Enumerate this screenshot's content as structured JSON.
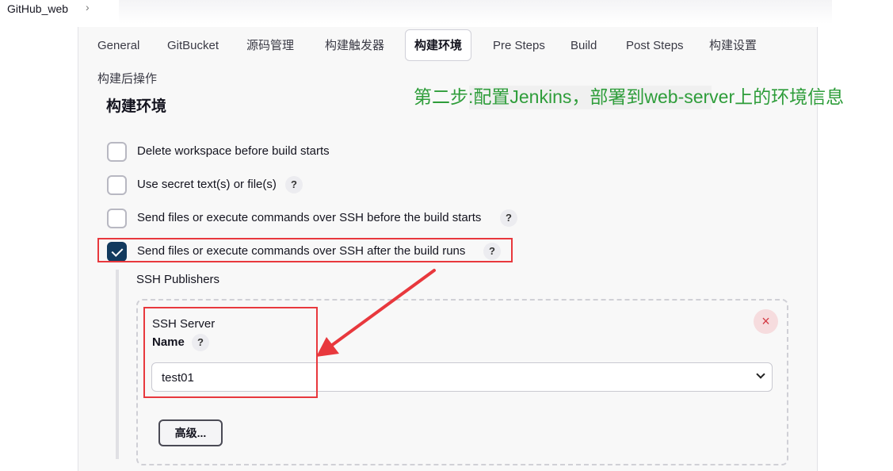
{
  "breadcrumb": {
    "project": "GitHub_web",
    "separator": "›"
  },
  "tabs": [
    {
      "label": "General"
    },
    {
      "label": "GitBucket"
    },
    {
      "label": "源码管理"
    },
    {
      "label": "构建触发器"
    },
    {
      "label": "构建环境",
      "active": true
    },
    {
      "label": "Pre Steps"
    },
    {
      "label": "Build"
    },
    {
      "label": "Post Steps"
    },
    {
      "label": "构建设置"
    },
    {
      "label": "构建后操作"
    }
  ],
  "section_title": "构建环境",
  "annotation": "第二步:配置Jenkins，部署到web-server上的环境信息",
  "options": [
    {
      "label": "Delete workspace before build starts",
      "checked": false,
      "help": ""
    },
    {
      "label": "Use secret text(s) or file(s)",
      "checked": false,
      "help": "?"
    },
    {
      "label": "Send files or execute commands over SSH before the build starts",
      "checked": false,
      "help": "?"
    },
    {
      "label": "Send files or execute commands over SSH after the build runs",
      "checked": true,
      "help": "?"
    }
  ],
  "ssh_publishers": {
    "title": "SSH Publishers",
    "server_label": "SSH Server",
    "name_label": "Name",
    "name_help": "?",
    "name_value": "test01",
    "remove_icon": "×",
    "advanced_button": "高级..."
  },
  "colors": {
    "annotation": "#2e9d3a",
    "highlight": "#e8383d",
    "checkbox_checked": "#123a5e"
  }
}
